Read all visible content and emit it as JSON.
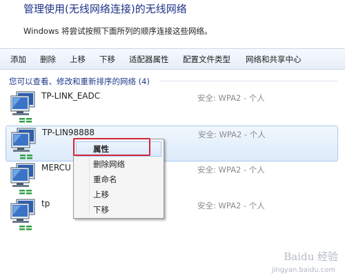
{
  "window": {
    "title": "管理使用(无线网络连接)的无线网络",
    "subtitle": "Windows 将尝试按照下面所列的顺序连接这些网络。"
  },
  "toolbar": {
    "items": [
      {
        "label": "添加"
      },
      {
        "label": "删除"
      },
      {
        "label": "上移"
      },
      {
        "label": "下移"
      },
      {
        "label": "适配器属性"
      },
      {
        "label": "配置文件类型"
      },
      {
        "label": "网络和共享中心"
      }
    ]
  },
  "section": {
    "header": "您可以查看、修改和重新排序的网络 (4)"
  },
  "networks": [
    {
      "name": "TP-LINK_EADC",
      "security": "安全: WPA2 - 个人"
    },
    {
      "name": "TP-LIN98888",
      "security": "安全: WPA2 - 个人",
      "selected": true
    },
    {
      "name": "MERCU",
      "security": "安全: WPA2 - 个人"
    },
    {
      "name": "tp",
      "security": "安全: WPA2 - 个人"
    }
  ],
  "context_menu": {
    "items": [
      {
        "label": "属性",
        "bold": true,
        "highlighted": true
      },
      {
        "label": "删除网络"
      },
      {
        "label": "重命名"
      },
      {
        "label": "上移"
      },
      {
        "label": "下移"
      }
    ]
  },
  "icons": {
    "network": "wireless-network-monitor-icon"
  },
  "colors": {
    "title": "#1e3287",
    "highlight_border": "#d4233b",
    "security_text": "#8a8a8a"
  },
  "watermark": {
    "text": "Baidu 经验",
    "url": "jingyan.baidu.com"
  }
}
